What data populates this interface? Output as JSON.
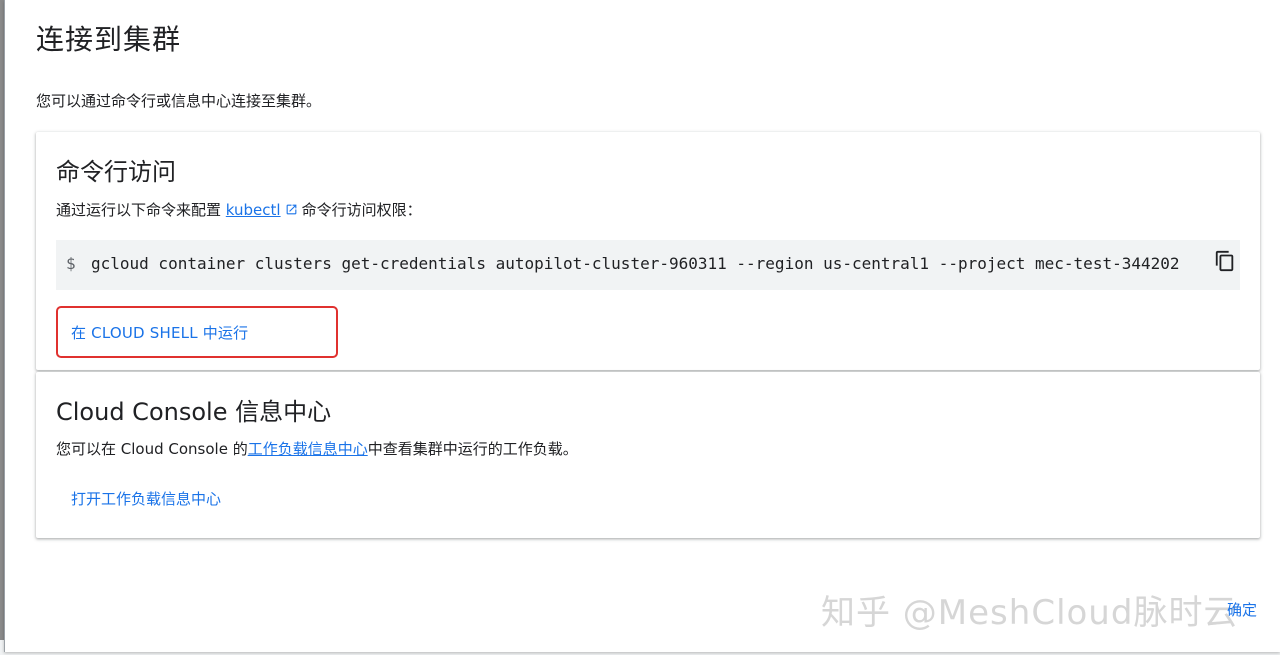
{
  "dialog": {
    "title": "连接到集群",
    "description": "您可以通过命令行或信息中心连接至集群。",
    "ok_label": "确定"
  },
  "cli_card": {
    "title": "命令行访问",
    "text_before": "通过运行以下命令来配置",
    "link_label": "kubectl",
    "text_after": "命令行访问权限：",
    "prompt": "$",
    "command": "gcloud container clusters get-credentials autopilot-cluster-960311 --region us-central1 --project mec-test-344202",
    "copy_icon": "copy-icon",
    "run_button_label": "在 CLOUD SHELL 中运行",
    "highlight_color": "#e0312f"
  },
  "console_card": {
    "title": "Cloud Console 信息中心",
    "text_before": "您可以在 Cloud Console 的",
    "link_label": "工作负载信息中心",
    "text_after": "中查看集群中运行的工作负载。",
    "open_link_label": "打开工作负载信息中心"
  },
  "watermark": "知乎 @MeshCloud脉时云",
  "colors": {
    "accent": "#1a73e8",
    "text": "#202124",
    "code_bg": "#f1f3f4"
  }
}
